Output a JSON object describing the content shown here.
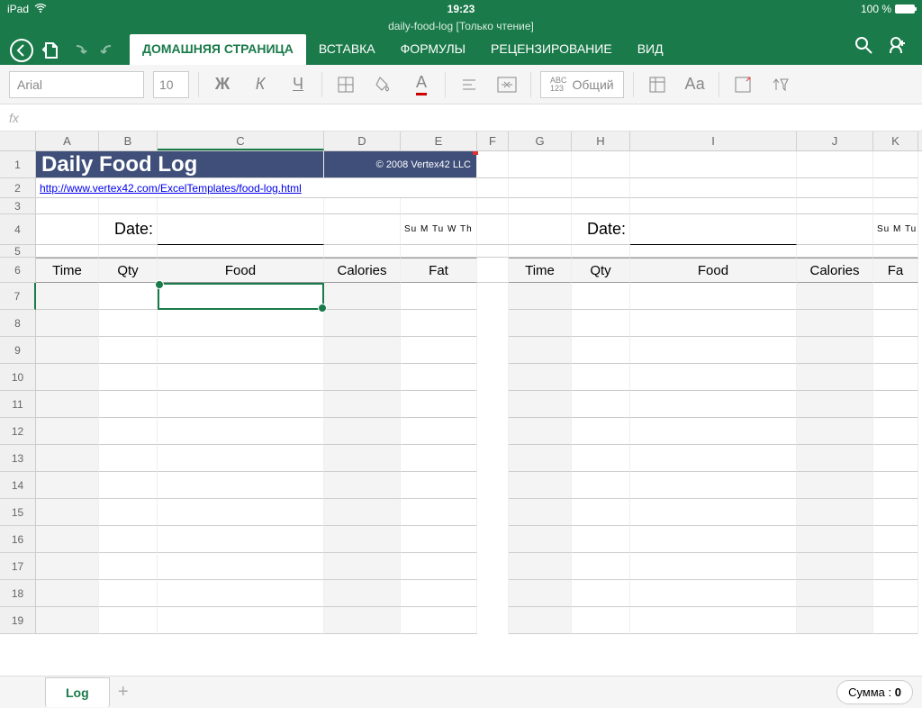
{
  "statusbar": {
    "device": "iPad",
    "time": "19:23",
    "battery": "100 %"
  },
  "doc": {
    "name": "daily-food-log",
    "readonly": "[Только чтение]"
  },
  "tabs": {
    "home": "ДОМАШНЯЯ СТРАНИЦА",
    "insert": "ВСТАВКА",
    "formulas": "ФОРМУЛЫ",
    "review": "РЕЦЕНЗИРОВАНИЕ",
    "view": "ВИД"
  },
  "toolbar": {
    "font": "Arial",
    "size": "10",
    "bold": "Ж",
    "italic": "К",
    "underline": "Ч",
    "abc123": "ABC",
    "general": "Общий",
    "aa": "Аа"
  },
  "formula": {
    "fx": "fx"
  },
  "cols": {
    "A": "A",
    "B": "B",
    "C": "C",
    "D": "D",
    "E": "E",
    "F": "F",
    "G": "G",
    "H": "H",
    "I": "I",
    "J": "J",
    "K": "K"
  },
  "rownums": [
    "1",
    "2",
    "3",
    "4",
    "5",
    "6",
    "7",
    "8",
    "9",
    "10",
    "11",
    "12",
    "13",
    "14",
    "15",
    "16",
    "17",
    "18",
    "19"
  ],
  "content": {
    "title": "Daily Food Log",
    "copyright": "© 2008 Vertex42 LLC",
    "link": "http://www.vertex42.com/ExcelTemplates/food-log.html",
    "date_label": "Date:",
    "days1": "Su  M  Tu  W  Th  F  Sa",
    "days2": "Su  M  Tu  W  Th",
    "headers": {
      "time": "Time",
      "qty": "Qty",
      "food": "Food",
      "cal": "Calories",
      "fat": "Fat",
      "fat2": "Fa"
    }
  },
  "sheet": {
    "tab": "Log",
    "sum_label": "Сумма :",
    "sum_val": "0"
  }
}
